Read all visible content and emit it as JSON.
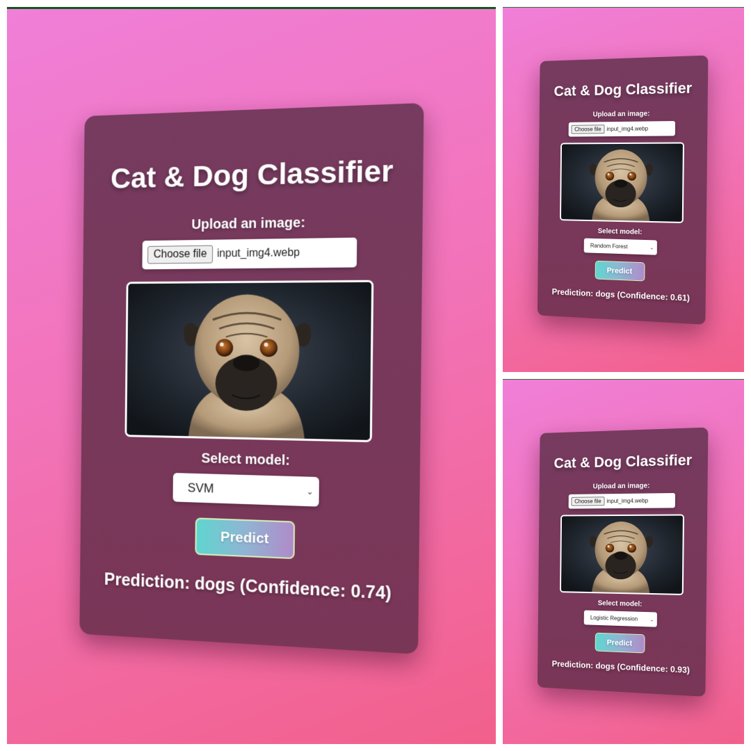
{
  "app": {
    "title": "Cat & Dog Classifier"
  },
  "colors": {
    "background_gradient": [
      "#f07fd8",
      "#f2608c"
    ],
    "card": "#763b5f",
    "predict_gradient": [
      "#5fd6d0",
      "#b08bc8"
    ]
  },
  "panels": [
    {
      "title": "Cat & Dog Classifier",
      "upload_label": "Upload an image:",
      "file_button": "Choose file",
      "file_name": "input_img4.webp",
      "preview_icon": "pug-photo",
      "model_label": "Select model:",
      "model_selected": "SVM",
      "predict_label": "Predict",
      "result": "Prediction: dogs (Confidence: 0.74)"
    },
    {
      "title": "Cat & Dog Classifier",
      "upload_label": "Upload an image:",
      "file_button": "Choose file",
      "file_name": "input_img4.webp",
      "preview_icon": "pug-photo",
      "model_label": "Select model:",
      "model_selected": "Random Forest",
      "predict_label": "Predict",
      "result": "Prediction: dogs (Confidence: 0.61)"
    },
    {
      "title": "Cat & Dog Classifier",
      "upload_label": "Upload an image:",
      "file_button": "Choose file",
      "file_name": "input_img4.webp",
      "preview_icon": "pug-photo",
      "model_label": "Select model:",
      "model_selected": "Logistic Regression",
      "predict_label": "Predict",
      "result": "Prediction: dogs (Confidence: 0.93)"
    }
  ]
}
